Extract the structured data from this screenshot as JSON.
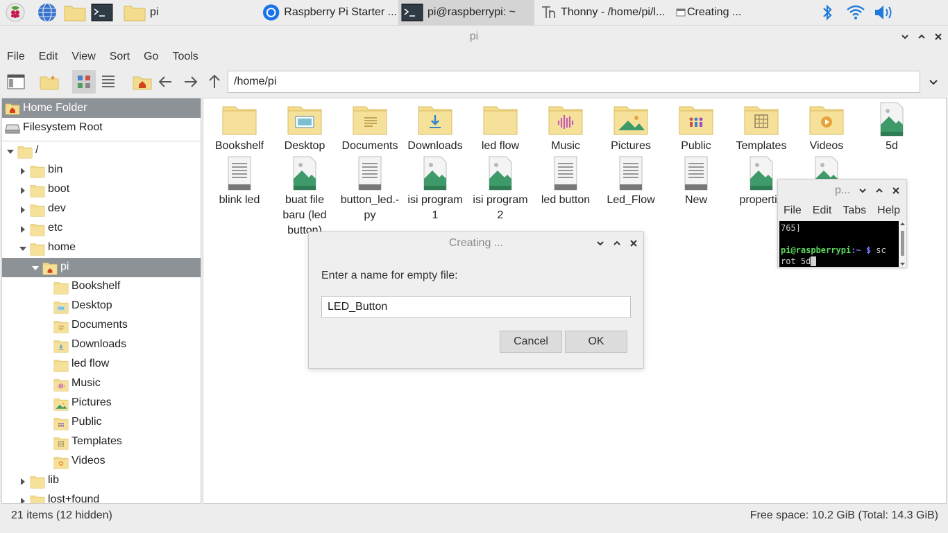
{
  "taskbar": {
    "launcher_icons": [
      "raspberry-icon",
      "browser-globe-icon",
      "file-manager-icon",
      "terminal-icon"
    ],
    "tasks": [
      {
        "label": "pi",
        "icon": "folder-icon",
        "active": false
      },
      {
        "label": "Raspberry Pi Starter ...",
        "icon": "chromium-icon",
        "active": false
      },
      {
        "label": "pi@raspberrypi: ~",
        "icon": "terminal-icon",
        "active": true
      },
      {
        "label": "Thonny  -  /home/pi/l...",
        "icon": "thonny-icon",
        "active": false
      },
      {
        "label": "Creating ...",
        "icon": "dialog-icon",
        "active": false
      }
    ],
    "tray_icons": [
      "bluetooth-icon",
      "wifi-icon",
      "volume-icon"
    ]
  },
  "window": {
    "title": "pi",
    "menu": [
      "File",
      "Edit",
      "View",
      "Sort",
      "Go",
      "Tools"
    ],
    "path": "/home/pi"
  },
  "places": [
    {
      "label": "Home Folder",
      "icon": "home-icon",
      "selected": true
    },
    {
      "label": "Filesystem Root",
      "icon": "drive-icon",
      "selected": false
    }
  ],
  "tree": [
    {
      "label": "/",
      "level": 0,
      "expanded": true
    },
    {
      "label": "bin",
      "level": 1
    },
    {
      "label": "boot",
      "level": 1
    },
    {
      "label": "dev",
      "level": 1
    },
    {
      "label": "etc",
      "level": 1
    },
    {
      "label": "home",
      "level": 1,
      "expanded": true
    },
    {
      "label": "pi",
      "level": 2,
      "expanded": true,
      "selected": true
    },
    {
      "label": "Bookshelf",
      "level": 3
    },
    {
      "label": "Desktop",
      "level": 3
    },
    {
      "label": "Documents",
      "level": 3
    },
    {
      "label": "Downloads",
      "level": 3
    },
    {
      "label": "led flow",
      "level": 3
    },
    {
      "label": "Music",
      "level": 3
    },
    {
      "label": "Pictures",
      "level": 3
    },
    {
      "label": "Public",
      "level": 3
    },
    {
      "label": "Templates",
      "level": 3
    },
    {
      "label": "Videos",
      "level": 3
    },
    {
      "label": "lib",
      "level": 1
    },
    {
      "label": "lost+found",
      "level": 1
    }
  ],
  "files": [
    {
      "label": "Bookshelf",
      "type": "folder"
    },
    {
      "label": "Desktop",
      "type": "folder-desktop"
    },
    {
      "label": "Documents",
      "type": "folder-documents"
    },
    {
      "label": "Downloads",
      "type": "folder-downloads"
    },
    {
      "label": "led flow",
      "type": "folder"
    },
    {
      "label": "Music",
      "type": "folder-music"
    },
    {
      "label": "Pictures",
      "type": "folder-pictures"
    },
    {
      "label": "Public",
      "type": "folder-public"
    },
    {
      "label": "Templates",
      "type": "folder-templates"
    },
    {
      "label": "Videos",
      "type": "folder-videos"
    },
    {
      "label": "5d",
      "type": "image"
    },
    {
      "label": "blink led",
      "type": "text"
    },
    {
      "label": "buat file baru (led button)",
      "type": "image"
    },
    {
      "label": "button_led.-py",
      "type": "text"
    },
    {
      "label": "isi program 1",
      "type": "image"
    },
    {
      "label": "isi program 2",
      "type": "image"
    },
    {
      "label": "led button",
      "type": "text"
    },
    {
      "label": "Led_Flow",
      "type": "text"
    },
    {
      "label": "New",
      "type": "text"
    },
    {
      "label": "propertie",
      "type": "image"
    },
    {
      "label": "",
      "type": "image"
    }
  ],
  "status": {
    "left": "21 items (12 hidden)",
    "right": "Free space: 10.2 GiB (Total: 14.3 GiB)"
  },
  "dialog": {
    "title": "Creating ...",
    "prompt": "Enter a name for empty file:",
    "value": "LED_Button",
    "cancel": "Cancel",
    "ok": "OK"
  },
  "terminal": {
    "title": "p...",
    "menu": [
      "File",
      "Edit",
      "Tabs",
      "Help"
    ],
    "line1": "765]",
    "prompt_user": "pi@raspberrypi",
    "prompt_path": ":~ $",
    "cmd1": " sc",
    "cmd2": "rot 5d"
  },
  "colors": {
    "selection": "#8d9296",
    "folder": "#f3dc8e",
    "folder_edge": "#d9bd63",
    "image_green": "#3f9a6a",
    "prompt_green": "#5fd75f",
    "prompt_blue": "#7a7aff",
    "bluetooth": "#1e7bdc"
  }
}
